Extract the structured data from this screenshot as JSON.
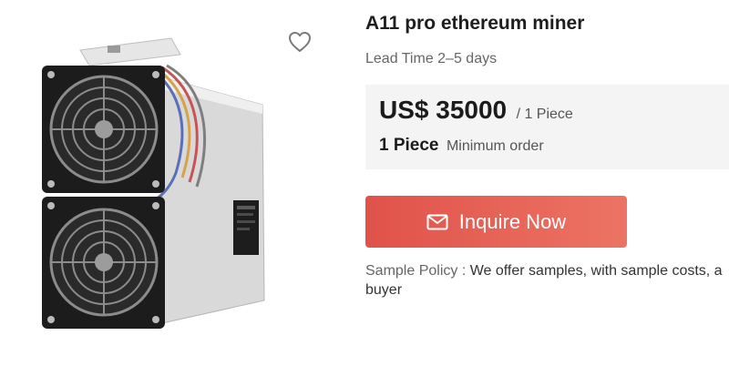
{
  "product": {
    "title": "A11 pro ethereum miner",
    "lead_time": "Lead Time 2–5 days"
  },
  "price": {
    "amount": "US$ 35000",
    "unit": "/ 1 Piece"
  },
  "moq": {
    "quantity": "1 Piece",
    "label": "Minimum order"
  },
  "inquire": {
    "label": "Inquire Now",
    "icon": "mail-icon"
  },
  "sample_policy": {
    "label": "Sample Policy :",
    "text_line1": "We offer samples, with sample costs, a",
    "text_line2": "buyer"
  },
  "favorite": {
    "icon": "heart-outline-icon"
  },
  "colors": {
    "button_start": "#e0524a",
    "button_end": "#ec7464",
    "panel_bg": "#f4f4f4"
  }
}
